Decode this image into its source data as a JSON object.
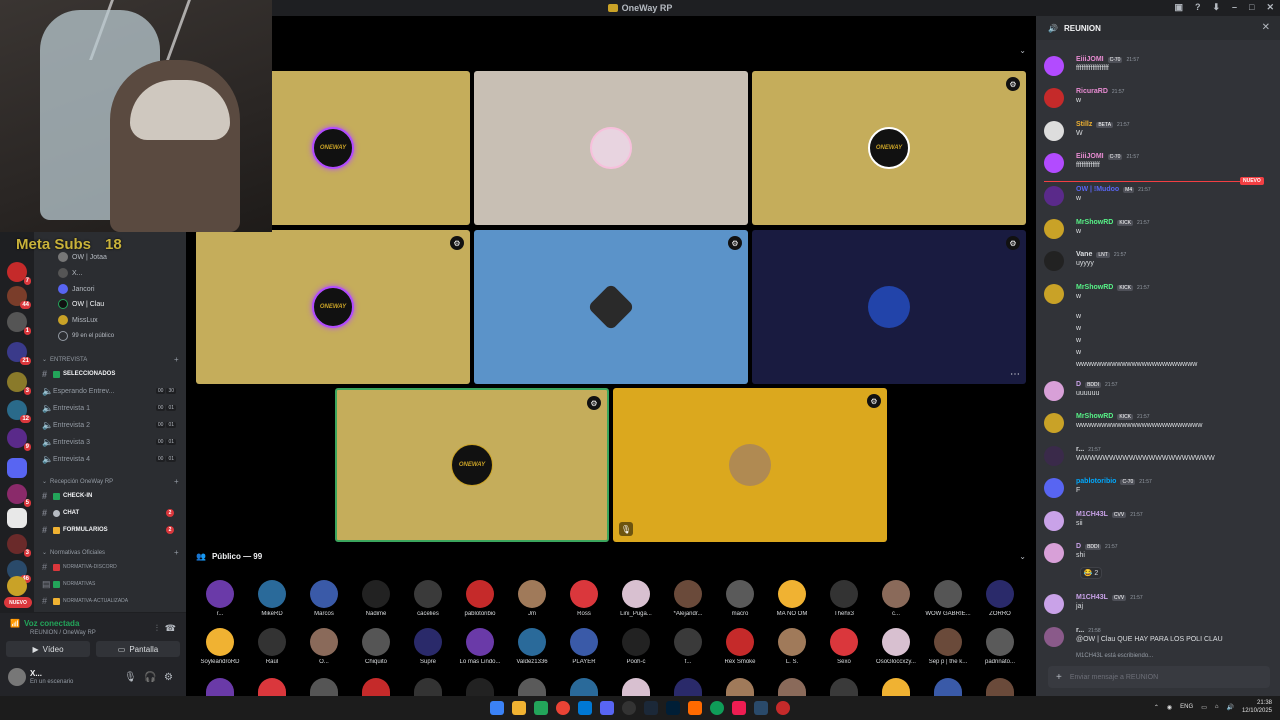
{
  "window": {
    "title": "OneWay RP"
  },
  "overlay": {
    "subs_label": "Meta Subs",
    "subs_value": "18"
  },
  "stage_users": [
    {
      "name": "OW | Jotaa"
    },
    {
      "name": "X..."
    },
    {
      "name": "Jancori"
    },
    {
      "name": "OW | Clau"
    },
    {
      "name": "MissLux"
    },
    {
      "name": "99 en el público"
    }
  ],
  "categories": {
    "entrevista": "ENTREVISTA",
    "recepcion": "Recepción OneWay RP",
    "normativas": "Normativas Oficiales"
  },
  "channels": {
    "seleccionados": "SELECCIONADOS",
    "esperando": "Esperando Entrev...",
    "esperando_counts": [
      "00",
      "30"
    ],
    "entrevista1": "Entrevista 1",
    "entrevista2": "Entrevista 2",
    "entrevista3": "Entrevista 3",
    "entrevista4": "Entrevista 4",
    "room_counts": [
      "00",
      "01"
    ],
    "checkin": "CHECK-IN",
    "chat": "CHAT",
    "chat_badge": "2",
    "formularios": "FORMULARIOS",
    "formularios_badge": "2",
    "normativa_discord": "NORMATIVA-DISCORD",
    "normativas": "NORMATIVAS",
    "normativa_actualizada": "NORMATIVA-ACTUALIZADA"
  },
  "voice": {
    "status": "Voz conectada",
    "channel": "REUNION / OneWay RP",
    "video_label": "Vídeo",
    "screen_label": "Pantalla"
  },
  "user": {
    "name": "X...",
    "status": "En un escenario"
  },
  "rail": {
    "nuevo_label": "NUEVO"
  },
  "stage": {
    "audience_label": "Público — 99",
    "tiles": [
      {
        "logo": "ONEWAY"
      },
      {
        "logo": ""
      },
      {
        "logo": "ONEWAY"
      },
      {
        "logo": "ONEWAY"
      },
      {
        "logo": ""
      },
      {
        "logo": ""
      },
      {
        "logo": "ONEWAY"
      },
      {
        "logo": ""
      }
    ],
    "audience": [
      "r...",
      "MikeRD",
      "Marcos",
      "Nadime",
      "cacelies",
      "pablotoribio",
      "Jm",
      "Ross",
      "Lini_Puga...",
      "*Alejandr...",
      "macro",
      "MA NO OM",
      "Thehx3",
      "c...",
      "WOW GABRIE...",
      "ZORRO",
      "SoyleandroRD",
      "Raúl",
      "O...",
      "Chiquito",
      "Supre",
      "Lo mas Lindo...",
      "Valdez1336",
      "PLAYER",
      "Pooh-c",
      "f...",
      "Rex Smoke",
      "L. S.",
      "Sexo",
      "OsoGloccxzy...",
      "Sep p | the k...",
      "padrinato..."
    ]
  },
  "chat": {
    "title": "REUNION",
    "new_label": "NUEVO",
    "input_placeholder": "Enviar mensaje a REUNION",
    "typing": "M1CH43L está escribiendo...",
    "reaction_count": "2",
    "messages": [
      {
        "name": "EiiiJOMI",
        "tag": "C-70",
        "time": "21:57",
        "text": "ffffffffffffffffff",
        "color": "#e78bd1"
      },
      {
        "name": "RicuraRD",
        "tag": "",
        "time": "21:57",
        "text": "w",
        "color": "#e78bd1"
      },
      {
        "name": "Stillz",
        "tag": "BETA",
        "time": "21:57",
        "text": "W",
        "color": "#f0b232"
      },
      {
        "name": "EiiiJOMI",
        "tag": "C-70",
        "time": "21:57",
        "text": "fffffffffffff",
        "color": "#e78bd1"
      },
      {
        "name": "OW | !Mudoo",
        "tag": "M4",
        "time": "21:57",
        "text": "w",
        "color": "#5865f2"
      },
      {
        "name": "MrShowRD",
        "tag": "KICK",
        "time": "21:57",
        "text": "w",
        "color": "#57f287"
      },
      {
        "name": "Vane",
        "tag": "LNT",
        "time": "21:57",
        "text": "uyyyy",
        "color": "#dbdee1"
      },
      {
        "name": "MrShowRD",
        "tag": "KICK",
        "time": "21:57",
        "text": "w",
        "color": "#57f287"
      },
      {
        "name": "D",
        "tag": "BDDI",
        "time": "21:57",
        "text": "uuuuuu",
        "color": "#c9a2e8"
      },
      {
        "name": "MrShowRD",
        "tag": "KICK",
        "time": "21:57",
        "text": "wwwwwwwwwwwwwwwwwwwwwwwww",
        "color": "#57f287"
      },
      {
        "name": "r...",
        "tag": "",
        "time": "21:57",
        "text": "WWWWWWWWWWWWWWWWWWWWW",
        "color": "#dbdee1"
      },
      {
        "name": "pablotoribio",
        "tag": "C-70",
        "time": "21:57",
        "text": "F",
        "color": "#00a8fc"
      },
      {
        "name": "M1CH43L",
        "tag": "CVV",
        "time": "21:57",
        "text": "sii",
        "color": "#c9a2e8"
      },
      {
        "name": "D",
        "tag": "BDDI",
        "time": "21:57",
        "text": "shi",
        "color": "#c9a2e8"
      },
      {
        "name": "M1CH43L",
        "tag": "CVV",
        "time": "21:57",
        "text": "jaj",
        "color": "#c9a2e8"
      },
      {
        "name": "r...",
        "tag": "",
        "time": "21:58",
        "text": "@OW | Clau QUE HAY PARA LOS POLI CLAU",
        "color": "#dbdee1"
      }
    ],
    "continuation": [
      "w",
      "w",
      "w",
      "w",
      "wwwwwwwwwwwwwwwwwwwwwwww"
    ]
  },
  "taskbar": {
    "lang": "ENG",
    "time": "21:38",
    "date": "12/10/2025"
  },
  "colors": {
    "gold": "#c5ad5b",
    "beige": "#c8bfb4",
    "blue": "#5b93c9",
    "navy": "#191b40",
    "yellow": "#dba81e",
    "accent": "#5865f2"
  }
}
